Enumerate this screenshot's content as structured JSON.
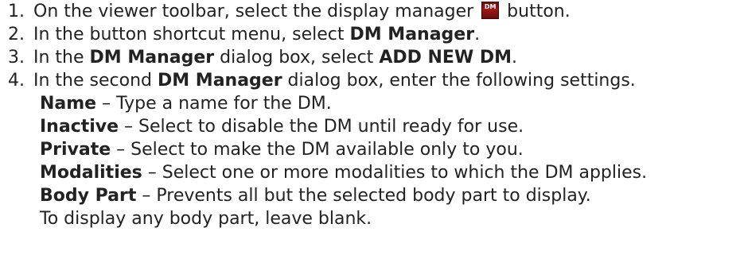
{
  "steps": [
    {
      "number": "1.",
      "pre": "On the viewer toolbar, select the display manager ",
      "icon": "DM",
      "post": " button."
    },
    {
      "number": "2.",
      "pre": "In the button shortcut menu, select ",
      "bold1": "DM Manager",
      "post": "."
    },
    {
      "number": "3.",
      "pre": "In the ",
      "bold1": "DM Manager",
      "mid": " dialog box, select ",
      "bold2": "ADD NEW DM",
      "post": "."
    },
    {
      "number": "4.",
      "pre": "In the second ",
      "bold1": "DM Manager",
      "post": " dialog box, enter the following settings."
    }
  ],
  "settings": [
    {
      "term": "Name",
      "desc": " – Type a name for the DM."
    },
    {
      "term": "Inactive",
      "desc": " – Select to disable the DM until ready for use."
    },
    {
      "term": "Private",
      "desc": " – Select to make the DM available only to you."
    },
    {
      "term": "Modalities",
      "desc": " – Select one or more modalities to which the DM applies."
    },
    {
      "term": "Body Part",
      "desc": " – Prevents all but the selected body part to display."
    }
  ],
  "note": "To display any body part, leave blank.",
  "icon_name": "display-manager-icon",
  "colors": {
    "text": "#222222",
    "icon_bg": "#8b1414"
  }
}
